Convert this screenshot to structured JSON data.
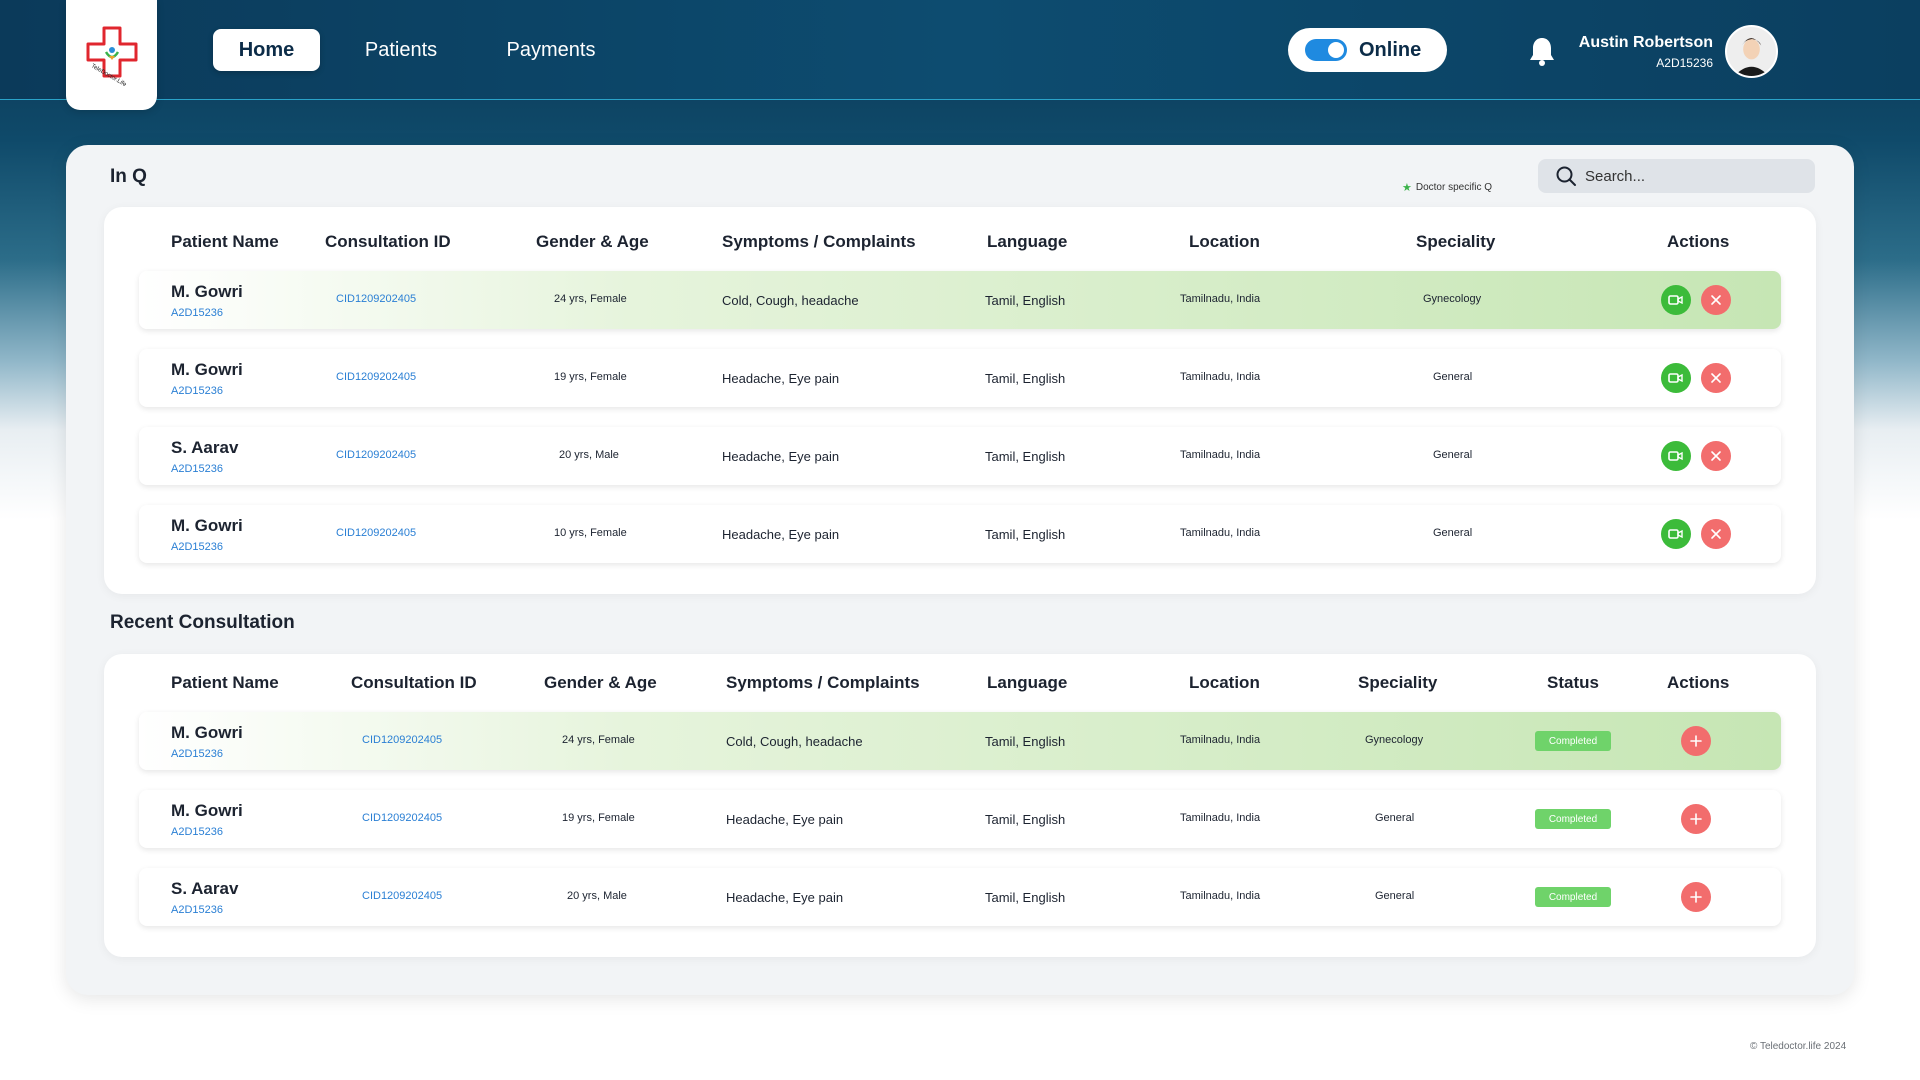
{
  "nav": {
    "home": "Home",
    "patients": "Patients",
    "payments": "Payments"
  },
  "status_toggle": {
    "label": "Online",
    "on": true
  },
  "user": {
    "name": "Austin Robertson",
    "id": "A2D15236"
  },
  "in_q": {
    "title": "In Q",
    "doctor_specific_note": "Doctor specific Q",
    "search_placeholder": "Search...",
    "headers": [
      "Patient Name",
      "Consultation ID",
      "Gender & Age",
      "Symptoms / Complaints",
      "Language",
      "Location",
      "Speciality",
      "Actions"
    ],
    "rows": [
      {
        "name": "M. Gowri",
        "pid": "A2D15236",
        "cid": "CID1209202405",
        "gender_age": "24 yrs, Female",
        "symptoms": "Cold, Cough, headache",
        "language": "Tamil, English",
        "location": "Tamilnadu, India",
        "speciality": "Gynecology",
        "highlighted": true
      },
      {
        "name": "M. Gowri",
        "pid": "A2D15236",
        "cid": "CID1209202405",
        "gender_age": "19 yrs, Female",
        "symptoms": "Headache, Eye pain",
        "language": "Tamil, English",
        "location": "Tamilnadu, India",
        "speciality": "General",
        "highlighted": false
      },
      {
        "name": "S. Aarav",
        "pid": "A2D15236",
        "cid": "CID1209202405",
        "gender_age": "20 yrs, Male",
        "symptoms": "Headache, Eye pain",
        "language": "Tamil, English",
        "location": "Tamilnadu, India",
        "speciality": "General",
        "highlighted": false
      },
      {
        "name": "M. Gowri",
        "pid": "A2D15236",
        "cid": "CID1209202405",
        "gender_age": "10 yrs, Female",
        "symptoms": "Headache, Eye pain",
        "language": "Tamil, English",
        "location": "Tamilnadu, India",
        "speciality": "General",
        "highlighted": false
      }
    ]
  },
  "recent": {
    "title": "Recent Consultation",
    "headers": [
      "Patient Name",
      "Consultation ID",
      "Gender & Age",
      "Symptoms / Complaints",
      "Language",
      "Location",
      "Speciality",
      "Status",
      "Actions"
    ],
    "rows": [
      {
        "name": "M. Gowri",
        "pid": "A2D15236",
        "cid": "CID1209202405",
        "gender_age": "24 yrs, Female",
        "symptoms": "Cold, Cough, headache",
        "language": "Tamil, English",
        "location": "Tamilnadu, India",
        "speciality": "Gynecology",
        "status": "Completed",
        "highlighted": true
      },
      {
        "name": "M. Gowri",
        "pid": "A2D15236",
        "cid": "CID1209202405",
        "gender_age": "19 yrs, Female",
        "symptoms": "Headache, Eye pain",
        "language": "Tamil, English",
        "location": "Tamilnadu, India",
        "speciality": "General",
        "status": "Completed",
        "highlighted": false
      },
      {
        "name": "S. Aarav",
        "pid": "A2D15236",
        "cid": "CID1209202405",
        "gender_age": "20 yrs, Male",
        "symptoms": "Headache, Eye pain",
        "language": "Tamil, English",
        "location": "Tamilnadu, India",
        "speciality": "General",
        "status": "Completed",
        "highlighted": false
      }
    ]
  },
  "footer": "© Teledoctor.life 2024",
  "colors": {
    "accent_blue": "#2a7fd4",
    "call_green": "#3cbb3a",
    "reject_red": "#f26d6d",
    "status_green": "#6fd36a",
    "header_navy": "#0b3a5a"
  },
  "icons": [
    "teledoctor-logo",
    "toggle-icon",
    "bell-icon",
    "avatar",
    "search-icon",
    "star-icon",
    "video-call-icon",
    "close-icon",
    "plus-icon"
  ]
}
